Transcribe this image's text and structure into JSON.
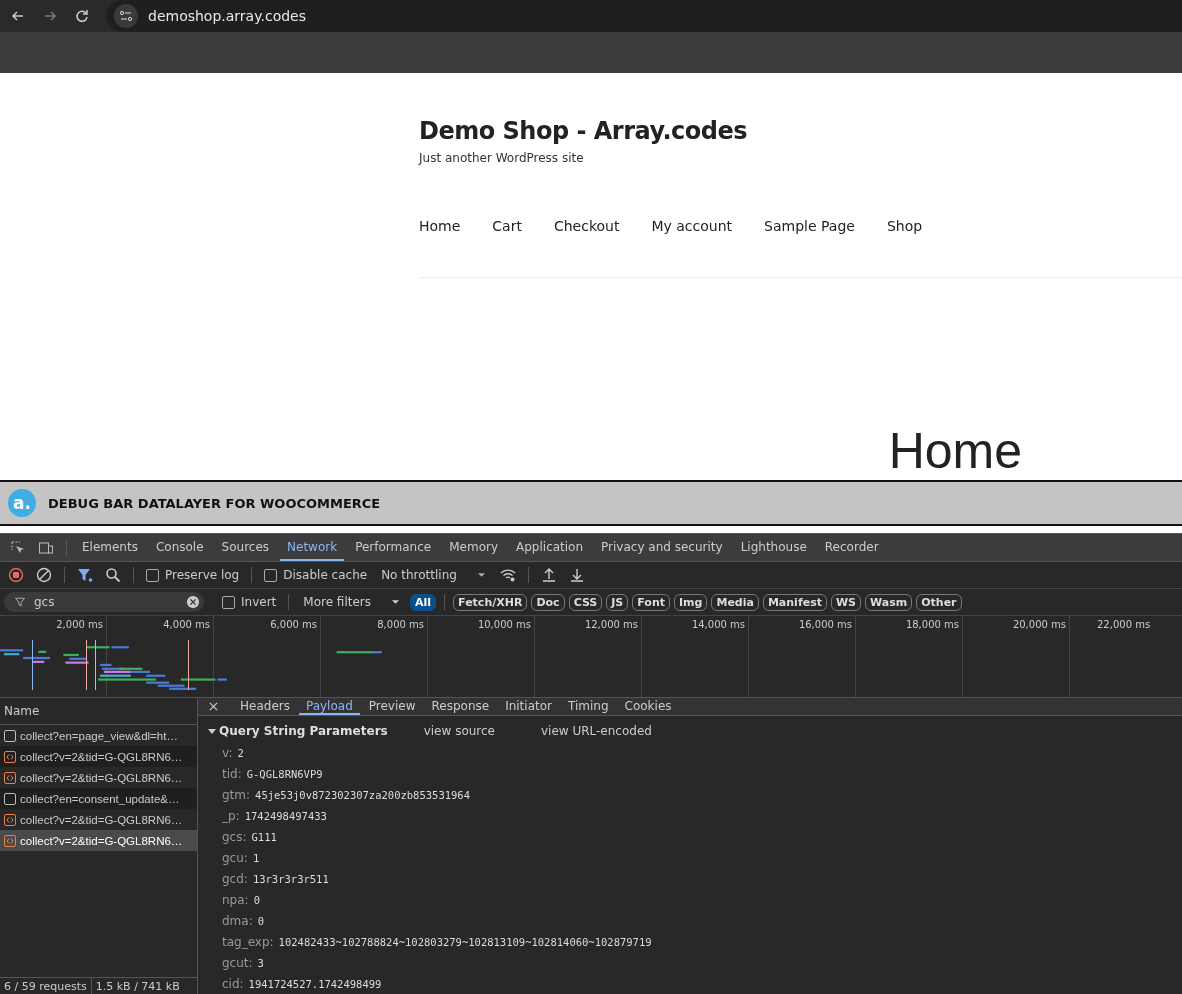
{
  "browser": {
    "url": "demoshop.array.codes"
  },
  "site": {
    "title": "Demo Shop - Array.codes",
    "tagline": "Just another WordPress site",
    "nav": [
      "Home",
      "Cart",
      "Checkout",
      "My account",
      "Sample Page",
      "Shop"
    ],
    "page_heading": "Home"
  },
  "debug_bar": {
    "logo": "a.",
    "title": "DEBUG BAR DATALAYER FOR WOOCOMMERCE"
  },
  "devtools": {
    "tabs": [
      {
        "label": "Elements",
        "selected": false
      },
      {
        "label": "Console",
        "selected": false
      },
      {
        "label": "Sources",
        "selected": false
      },
      {
        "label": "Network",
        "selected": true
      },
      {
        "label": "Performance",
        "selected": false
      },
      {
        "label": "Memory",
        "selected": false
      },
      {
        "label": "Application",
        "selected": false
      },
      {
        "label": "Privacy and security",
        "selected": false
      },
      {
        "label": "Lighthouse",
        "selected": false
      },
      {
        "label": "Recorder",
        "selected": false
      }
    ],
    "toolbar": {
      "recording": true,
      "preserve_log": {
        "label": "Preserve log",
        "checked": false
      },
      "disable_cache": {
        "label": "Disable cache",
        "checked": false
      },
      "throttling": "No throttling"
    },
    "filter": {
      "value": "gcs",
      "invert": {
        "label": "Invert",
        "checked": false
      },
      "more_filters": "More filters",
      "types": [
        {
          "label": "All",
          "selected": true
        },
        {
          "label": "Fetch/XHR",
          "selected": false
        },
        {
          "label": "Doc",
          "selected": false
        },
        {
          "label": "CSS",
          "selected": false
        },
        {
          "label": "JS",
          "selected": false
        },
        {
          "label": "Font",
          "selected": false
        },
        {
          "label": "Img",
          "selected": false
        },
        {
          "label": "Media",
          "selected": false
        },
        {
          "label": "Manifest",
          "selected": false
        },
        {
          "label": "WS",
          "selected": false
        },
        {
          "label": "Wasm",
          "selected": false
        },
        {
          "label": "Other",
          "selected": false
        }
      ]
    },
    "timeline_ticks": [
      "2,000 ms",
      "4,000 ms",
      "6,000 ms",
      "8,000 ms",
      "10,000 ms",
      "12,000 ms",
      "14,000 ms",
      "16,000 ms",
      "18,000 ms",
      "20,000 ms",
      "22,000 ms"
    ],
    "requests_header": "Name",
    "requests": [
      {
        "name": "collect?en=page_view&dl=ht…",
        "kind": "document",
        "selected": false
      },
      {
        "name": "collect?v=2&tid=G-QGL8RN6…",
        "kind": "fetch",
        "selected": false
      },
      {
        "name": "collect?v=2&tid=G-QGL8RN6…",
        "kind": "fetch",
        "selected": false
      },
      {
        "name": "collect?en=consent_update&…",
        "kind": "document",
        "selected": false
      },
      {
        "name": "collect?v=2&tid=G-QGL8RN6…",
        "kind": "fetch",
        "selected": false
      },
      {
        "name": "collect?v=2&tid=G-QGL8RN6…",
        "kind": "fetch",
        "selected": true
      }
    ],
    "status_bar": [
      "6 / 59 requests",
      "1.5 kB / 741 kB"
    ],
    "detail_tabs": [
      {
        "label": "Headers",
        "selected": false
      },
      {
        "label": "Payload",
        "selected": true
      },
      {
        "label": "Preview",
        "selected": false
      },
      {
        "label": "Response",
        "selected": false
      },
      {
        "label": "Initiator",
        "selected": false
      },
      {
        "label": "Timing",
        "selected": false
      },
      {
        "label": "Cookies",
        "selected": false
      }
    ],
    "payload": {
      "section": "Query String Parameters",
      "expanded": true,
      "links": [
        "view source",
        "view URL-encoded"
      ],
      "params": [
        {
          "key": "v:",
          "value": "2"
        },
        {
          "key": "tid:",
          "value": "G-QGL8RN6VP9"
        },
        {
          "key": "gtm:",
          "value": "45je53j0v872302307za200zb853531964"
        },
        {
          "key": "_p:",
          "value": "1742498497433"
        },
        {
          "key": "gcs:",
          "value": "G111"
        },
        {
          "key": "gcu:",
          "value": "1"
        },
        {
          "key": "gcd:",
          "value": "13r3r3r3r511"
        },
        {
          "key": "npa:",
          "value": "0"
        },
        {
          "key": "dma:",
          "value": "0"
        },
        {
          "key": "tag_exp:",
          "value": "102482433~102788824~102803279~102813109~102814060~102879719"
        },
        {
          "key": "gcut:",
          "value": "3"
        },
        {
          "key": "cid:",
          "value": "1941724527.1742498499"
        }
      ]
    }
  }
}
